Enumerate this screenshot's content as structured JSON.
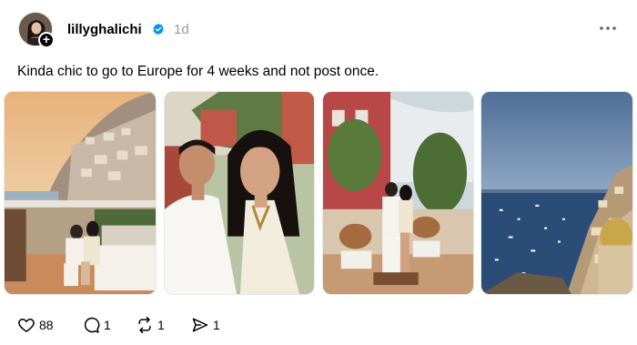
{
  "post": {
    "username": "lillyghalichi",
    "time": "1d",
    "caption": "Kinda chic to go to Europe for 4 weeks and not post once.",
    "verified": true
  },
  "icons": {
    "avatar_plus": "plus-icon",
    "verified": "verified-badge-icon",
    "more": "more-dots-icon",
    "like": "heart-icon",
    "comment": "comment-icon",
    "repost": "repost-icon",
    "share": "send-icon"
  },
  "actions": {
    "likes": "88",
    "comments": "1",
    "reposts": "1",
    "shares": "1"
  },
  "colors": {
    "verified": "#0095f6",
    "muted": "#999999"
  }
}
